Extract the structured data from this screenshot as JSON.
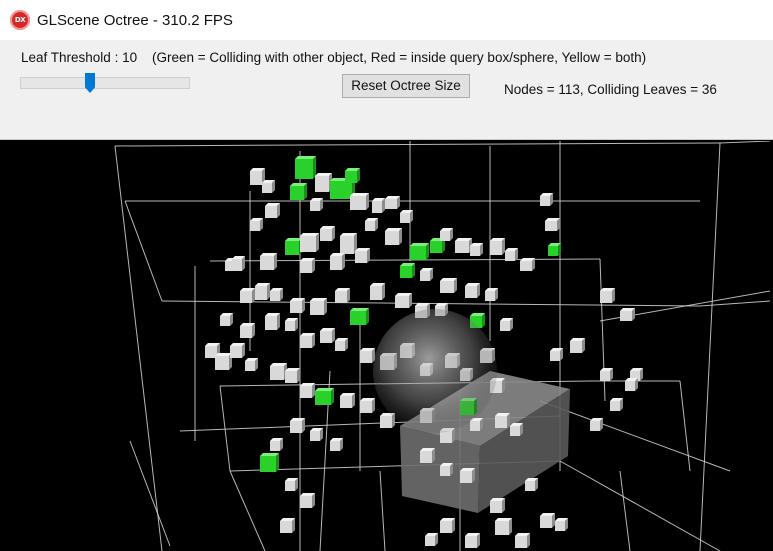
{
  "window": {
    "title": "GLScene Octree - 310.2 FPS",
    "icon": "glscene-app-icon"
  },
  "controls": {
    "leaf_threshold_label": "Leaf Threshold : 10",
    "legend": "(Green = Colliding with other object, Red = inside query box/sphere, Yellow = both)",
    "leaf_threshold_slider": {
      "value": 10,
      "position_fraction": 0.41
    },
    "reset_button_label": "Reset Octree Size",
    "stats_text": "Nodes = 113, Colliding Leaves = 36"
  },
  "scene": {
    "background_color": "#000000",
    "grid_line_color": "#d8d8d8",
    "cube_color": "#d9d9d9",
    "colliding_color": "#2ad12a",
    "query_sphere_color": "#b0b0b0",
    "query_box_color": "#7d7d7d"
  }
}
